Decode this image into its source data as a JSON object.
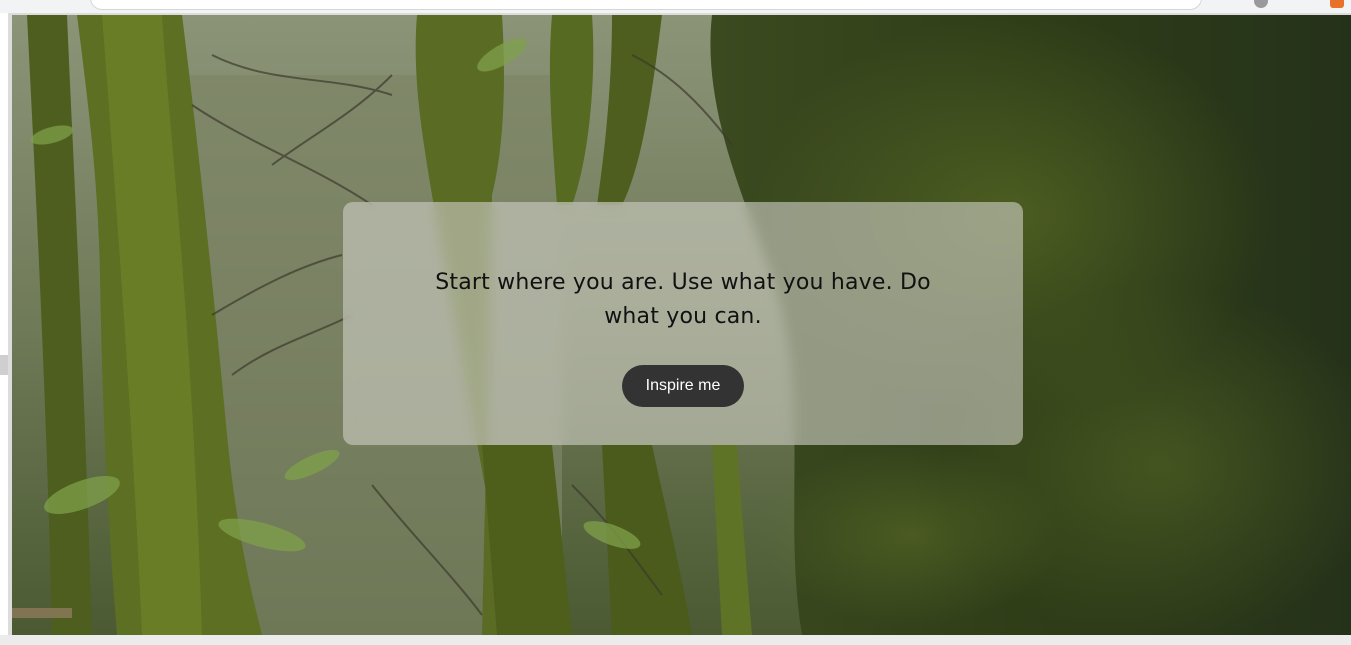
{
  "quote": {
    "text": "Start where you are. Use what you have. Do what you can."
  },
  "actions": {
    "inspire_label": "Inspire me"
  },
  "background": {
    "description_icon": "forest-photo"
  },
  "colors": {
    "card": "#cdcdc3",
    "button": "#333333",
    "button_text": "#ffffff"
  }
}
